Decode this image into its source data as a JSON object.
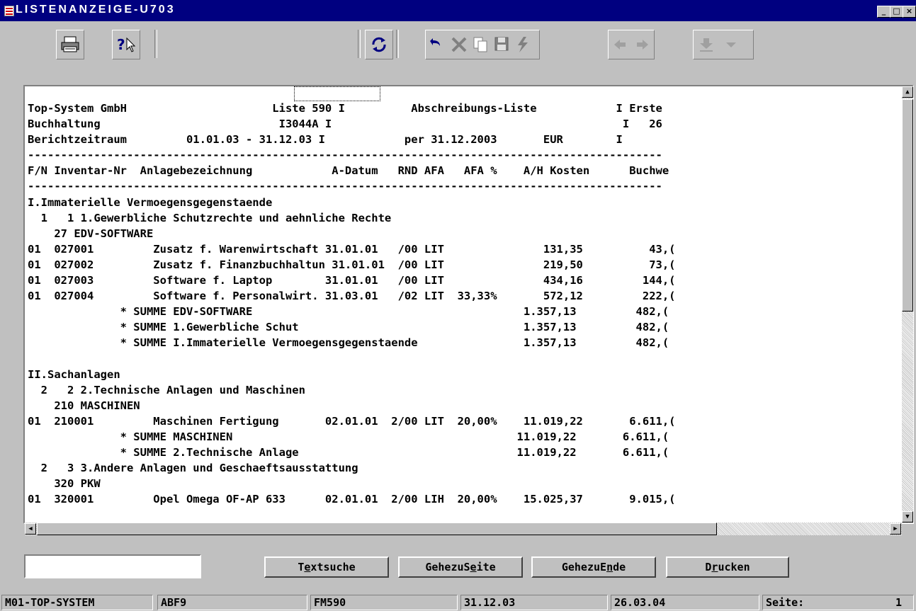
{
  "window": {
    "title": "LISTENANZEIGE-U703",
    "buttons": {
      "minimize": "_",
      "maximize": "□",
      "close": "×"
    }
  },
  "toolbar": {
    "icons": [
      "printer-icon",
      "help-pointer-icon",
      "refresh-icon",
      "undo-icon",
      "delete-icon",
      "copy-icon",
      "save-icon",
      "flash-icon",
      "arrow-left-icon",
      "arrow-right-icon",
      "download-icon",
      "dropdown-icon"
    ]
  },
  "report": {
    "lines": [
      "Top-System GmbH                      Liste 590 I          Abschreibungs-Liste            I Erste",
      "Buchhaltung                           I3044A I                                            I   26",
      "Berichtzeitraum         01.01.03 - 31.12.03 I            per 31.12.2003       EUR        I",
      "------------------------------------------------------------------------------------------------",
      "F/N Inventar-Nr  Anlagebezeichnung            A-Datum   RND AFA   AFA %    A/H Kosten      Buchwe",
      "------------------------------------------------------------------------------------------------",
      "I.Immaterielle Vermoegensgegenstaende",
      "  1   1 1.Gewerbliche Schutzrechte und aehnliche Rechte",
      "    27 EDV-SOFTWARE",
      "01  027001         Zusatz f. Warenwirtschaft 31.01.01   /00 LIT               131,35          43,(",
      "01  027002         Zusatz f. Finanzbuchhaltun 31.01.01  /00 LIT               219,50          73,(",
      "01  027003         Software f. Laptop        31.01.01   /00 LIT               434,16         144,(",
      "01  027004         Software f. Personalwirt. 31.03.01   /02 LIT  33,33%       572,12         222,(",
      "              * SUMME EDV-SOFTWARE                                         1.357,13         482,(",
      "              * SUMME 1.Gewerbliche Schut                                  1.357,13         482,(",
      "              * SUMME I.Immaterielle Vermoegensgegenstaende                1.357,13         482,(",
      "",
      "II.Sachanlagen",
      "  2   2 2.Technische Anlagen und Maschinen",
      "    210 MASCHINEN",
      "01  210001         Maschinen Fertigung       02.01.01  2/00 LIT  20,00%    11.019,22       6.611,(",
      "              * SUMME MASCHINEN                                           11.019,22       6.611,(",
      "              * SUMME 2.Technische Anlage                                 11.019,22       6.611,(",
      "  2   3 3.Andere Anlagen und Geschaeftsausstattung",
      "    320 PKW",
      "01  320001         Opel Omega OF-AP 633      02.01.01  2/00 LIH  20,00%    15.025,37       9.015,("
    ]
  },
  "search": {
    "value": ""
  },
  "buttons": {
    "textsuche": {
      "a": "T",
      "u": "e",
      "b": "xtsuche"
    },
    "gehezuseite": {
      "a": "GehezuS",
      "u": "e",
      "b": "ite"
    },
    "gehezuende": {
      "a": "GehezuE",
      "u": "n",
      "b": "de"
    },
    "drucken": {
      "a": "D",
      "u": "r",
      "b": "ucken"
    }
  },
  "status": {
    "system": "M01-TOP-SYSTEM",
    "code": "ABF9",
    "form": "FM590",
    "date1": "31.12.03",
    "date2": "26.03.04",
    "page_label": "Seite:",
    "page_num": "1"
  }
}
